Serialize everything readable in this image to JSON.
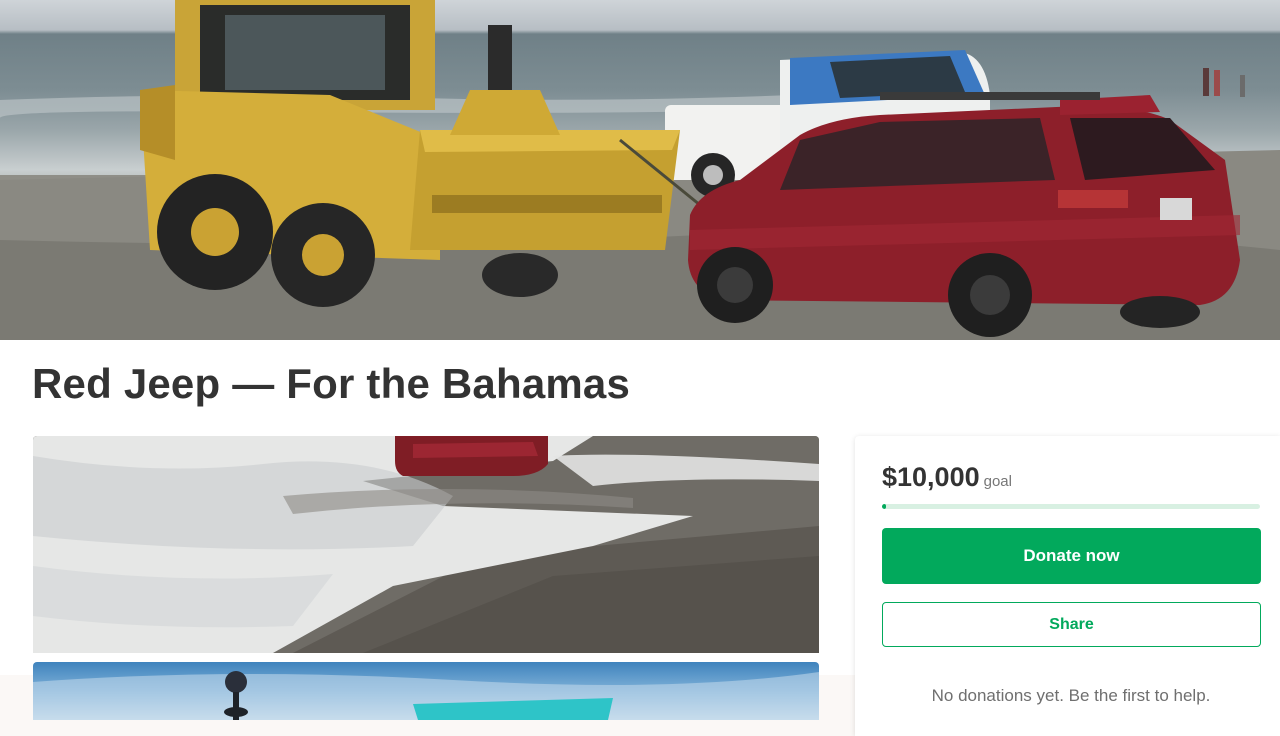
{
  "campaign": {
    "title": "Red Jeep — For the Bahamas"
  },
  "donation_card": {
    "goal_amount": "$10,000",
    "goal_label": "goal",
    "progress_fraction": 0.01,
    "donate_label": "Donate now",
    "share_label": "Share",
    "empty_message": "No donations yet. Be the first to help."
  },
  "colors": {
    "brand_green": "#02a95c",
    "progress_track": "#d8f0e2",
    "title_text": "#333333"
  }
}
